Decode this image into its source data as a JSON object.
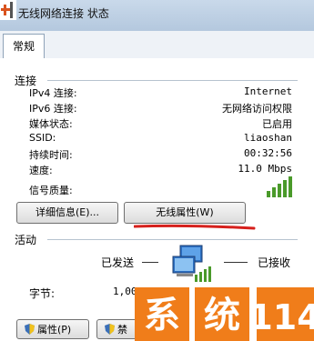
{
  "window": {
    "title": "无线网络连接 状态"
  },
  "tabs": [
    {
      "label": "常规"
    }
  ],
  "connection": {
    "section_label": "连接",
    "rows": [
      {
        "label": "IPv4 连接:",
        "value": "Internet"
      },
      {
        "label": "IPv6 连接:",
        "value": "无网络访问权限"
      },
      {
        "label": "媒体状态:",
        "value": "已启用"
      },
      {
        "label": "SSID:",
        "value": "liaoshan"
      },
      {
        "label": "持续时间:",
        "value": "00:32:56"
      },
      {
        "label": "速度:",
        "value": "11.0 Mbps"
      }
    ],
    "signal_label": "信号质量:",
    "signal_bars": 5,
    "details_button": "详细信息(E)...",
    "wireless_props_button": "无线属性(W)"
  },
  "activity": {
    "section_label": "活动",
    "sent_label": "已发送",
    "received_label": "已接收",
    "bytes_label": "字节:",
    "bytes_sent": "1,00"
  },
  "footer": {
    "properties_button": "属性(P)",
    "disable_button": "禁"
  },
  "watermark": {
    "text_1": "系",
    "text_2": "统",
    "text_3": "114"
  },
  "colors": {
    "accent_red": "#d6201c",
    "watermark_orange": "#f07d1a",
    "signal_green": "#4a9a2a"
  }
}
